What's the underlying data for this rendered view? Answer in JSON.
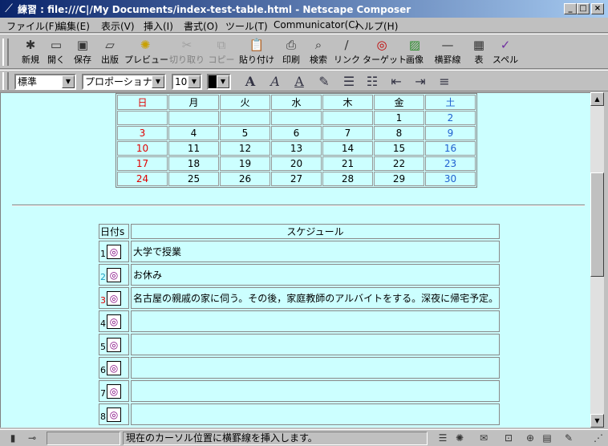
{
  "window": {
    "title": "練習 : file:///C|/My Documents/index-test-table.html - Netscape Composer"
  },
  "menu": [
    "ファイル(F)",
    "編集(E)",
    "表示(V)",
    "挿入(I)",
    "書式(O)",
    "ツール(T)",
    "Communicator(C)",
    "ヘルプ(H)"
  ],
  "toolbar": [
    {
      "label": "新規",
      "icon": "new-page-icon",
      "enabled": true
    },
    {
      "label": "開く",
      "icon": "open-icon",
      "enabled": true
    },
    {
      "label": "保存",
      "icon": "save-icon",
      "enabled": true
    },
    {
      "label": "出版",
      "icon": "publish-icon",
      "enabled": true
    },
    {
      "label": "プレビュー",
      "icon": "preview-icon",
      "enabled": true
    },
    {
      "label": "切り取り",
      "icon": "cut-icon",
      "enabled": false
    },
    {
      "label": "コピー",
      "icon": "copy-icon",
      "enabled": false
    },
    {
      "label": "貼り付け",
      "icon": "paste-icon",
      "enabled": true
    },
    {
      "label": "印刷",
      "icon": "print-icon",
      "enabled": true
    },
    {
      "label": "検索",
      "icon": "find-icon",
      "enabled": true
    },
    {
      "label": "リンク",
      "icon": "link-icon",
      "enabled": true
    },
    {
      "label": "ターゲット",
      "icon": "target-icon",
      "enabled": true
    },
    {
      "label": "画像",
      "icon": "image-icon",
      "enabled": true
    },
    {
      "label": "横罫線",
      "icon": "hrule-icon",
      "enabled": true
    },
    {
      "label": "表",
      "icon": "table-icon",
      "enabled": true
    },
    {
      "label": "スペル",
      "icon": "spell-icon",
      "enabled": true
    }
  ],
  "format": {
    "paragraph_style": "標準",
    "font": "プロポーショナル",
    "size": "10",
    "text_color": "#000000"
  },
  "calendar": {
    "headers": [
      "日",
      "月",
      "火",
      "水",
      "木",
      "金",
      "土"
    ],
    "rows": [
      [
        "",
        "",
        "",
        "",
        "",
        "1",
        "2"
      ],
      [
        "3",
        "4",
        "5",
        "6",
        "7",
        "8",
        "9"
      ],
      [
        "10",
        "11",
        "12",
        "13",
        "14",
        "15",
        "16"
      ],
      [
        "17",
        "18",
        "19",
        "20",
        "21",
        "22",
        "23"
      ],
      [
        "24",
        "25",
        "26",
        "27",
        "28",
        "29",
        "30"
      ]
    ],
    "sunday_color": "#e00000",
    "saturday_color": "#2060d0"
  },
  "schedule": {
    "headers": [
      "日付s",
      "スケジュール"
    ],
    "rows": [
      {
        "date": "1",
        "date_color": "#000000",
        "text": "大学で授業"
      },
      {
        "date": "2",
        "date_color": "#20a0c0",
        "text": "お休み"
      },
      {
        "date": "3",
        "date_color": "#e00000",
        "text": "名古屋の親戚の家に伺う。その後，家庭教師のアルバイトをする。深夜に帰宅予定。"
      },
      {
        "date": "4",
        "date_color": "#000000",
        "text": ""
      },
      {
        "date": "5",
        "date_color": "#000000",
        "text": ""
      },
      {
        "date": "6",
        "date_color": "#000000",
        "text": ""
      },
      {
        "date": "7",
        "date_color": "#000000",
        "text": ""
      },
      {
        "date": "8",
        "date_color": "#000000",
        "text": ""
      }
    ]
  },
  "status": {
    "message": "現在のカーソル位置に横罫線を挿入します。"
  }
}
